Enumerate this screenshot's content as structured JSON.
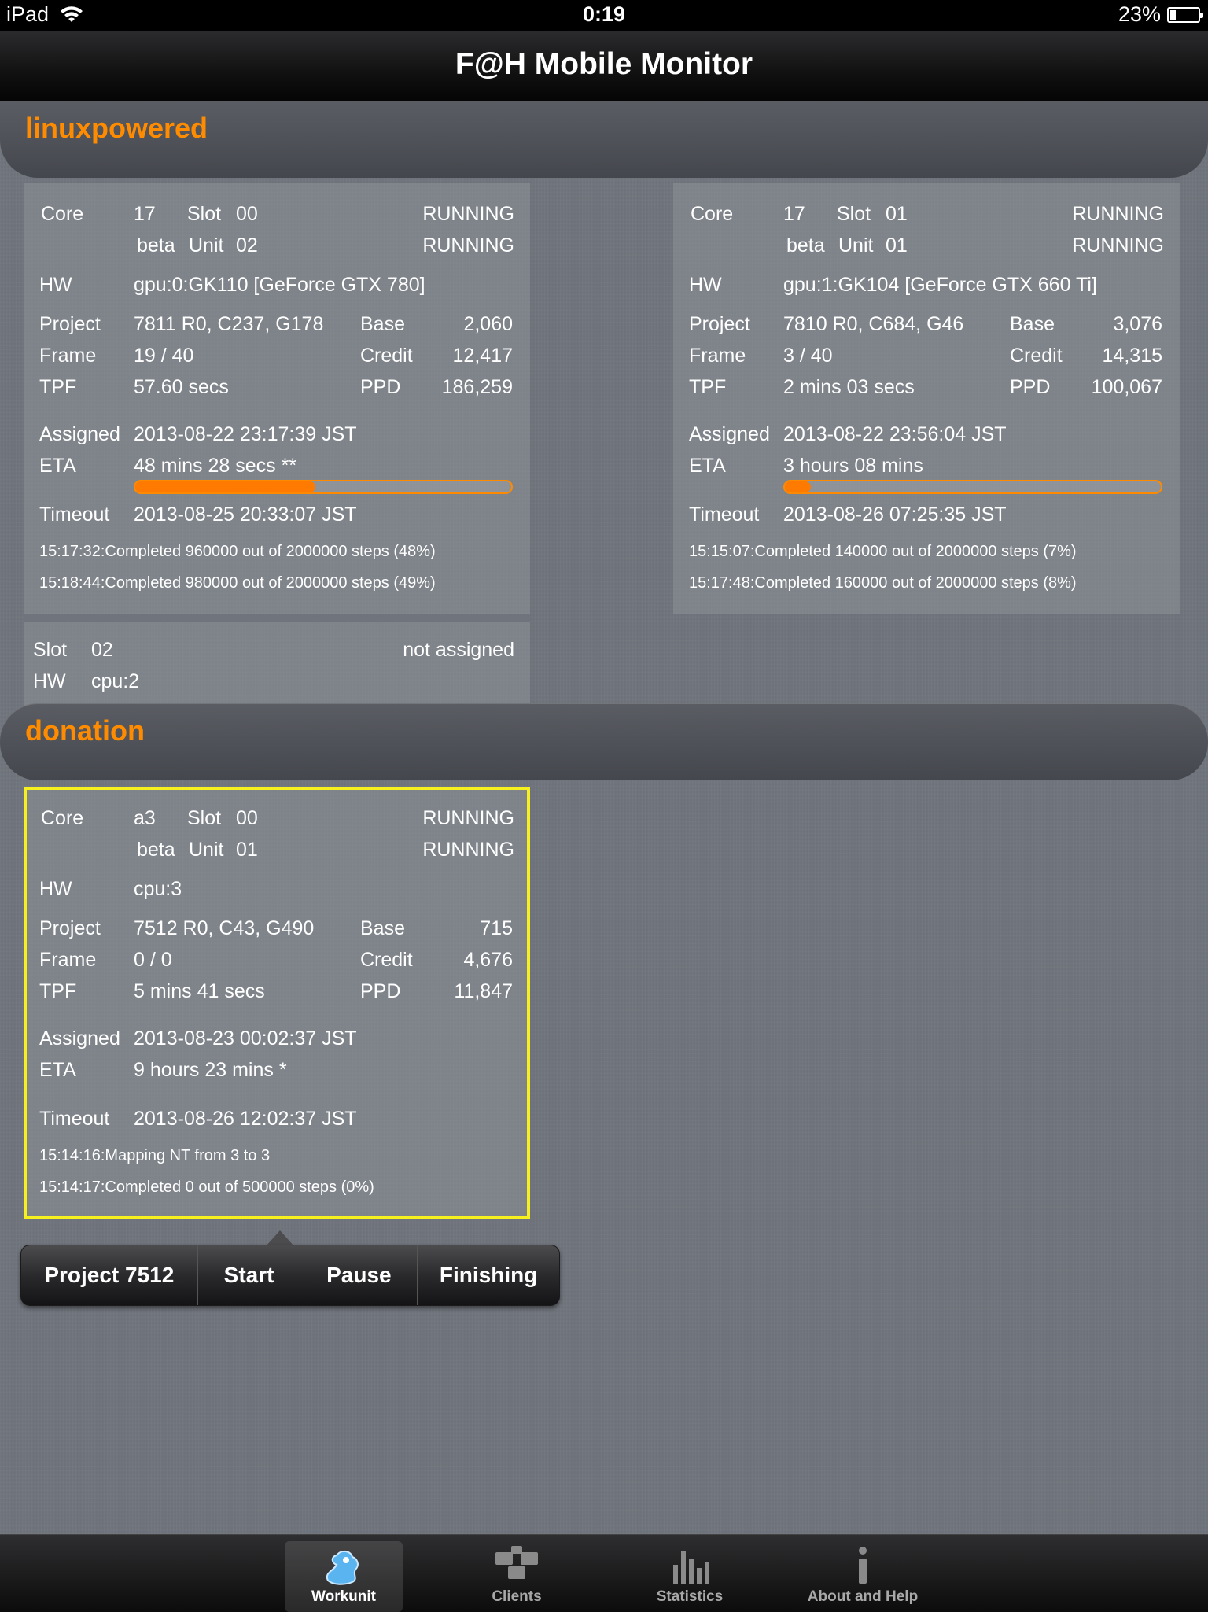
{
  "statusbar": {
    "device": "iPad",
    "time": "0:19",
    "battery": "23%"
  },
  "navbar": {
    "title": "F@H Mobile Monitor"
  },
  "clients": [
    {
      "name": "linuxpowered",
      "slots": [
        {
          "core": "17",
          "slot": "00",
          "beta": "beta",
          "unit": "02",
          "state1": "RUNNING",
          "state2": "RUNNING",
          "hw": "gpu:0:GK110 [GeForce GTX 780]",
          "project": "7811 R0, C237, G178",
          "base": "2,060",
          "frame": "19 / 40",
          "credit": "12,417",
          "tpf": "57.60 secs",
          "ppd": "186,259",
          "assigned": "2013-08-22 23:17:39 JST",
          "eta": "48 mins 28 secs **",
          "progress": 0.48,
          "timeout": "2013-08-25 20:33:07 JST",
          "log": [
            "15:17:32:Completed 960000 out of 2000000 steps (48%)",
            "15:18:44:Completed 980000 out of 2000000 steps (49%)"
          ]
        },
        {
          "core": "17",
          "slot": "01",
          "beta": "beta",
          "unit": "01",
          "state1": "RUNNING",
          "state2": "RUNNING",
          "hw": "gpu:1:GK104 [GeForce GTX 660 Ti]",
          "project": "7810 R0, C684, G46",
          "base": "3,076",
          "frame": "3 / 40",
          "credit": "14,315",
          "tpf": "2 mins 03 secs",
          "ppd": "100,067",
          "assigned": "2013-08-22 23:56:04 JST",
          "eta": "3 hours 08 mins",
          "progress": 0.07,
          "timeout": "2013-08-26 07:25:35 JST",
          "log": [
            "15:15:07:Completed 140000 out of 2000000 steps (7%)",
            "15:17:48:Completed 160000 out of 2000000 steps (8%)"
          ]
        }
      ],
      "unassigned": {
        "slot": "02",
        "status": "not assigned",
        "hw": "cpu:2"
      }
    },
    {
      "name": "donation",
      "slots": [
        {
          "core": "a3",
          "slot": "00",
          "beta": "beta",
          "unit": "01",
          "state1": "RUNNING",
          "state2": "RUNNING",
          "hw": "cpu:3",
          "project": "7512 R0, C43, G490",
          "base": "715",
          "frame": "0 / 0",
          "credit": "4,676",
          "tpf": "5 mins 41 secs",
          "ppd": "11,847",
          "assigned": "2013-08-23 00:02:37 JST",
          "eta": "9 hours 23 mins *",
          "timeout": "2013-08-26 12:02:37 JST",
          "log": [
            "15:14:16:Mapping NT from 3 to 3",
            "15:14:17:Completed 0 out of 500000 steps  (0%)"
          ]
        }
      ]
    }
  ],
  "labels": {
    "core": "Core",
    "slot": "Slot",
    "unit": "Unit",
    "hw": "HW",
    "project": "Project",
    "frame": "Frame",
    "tpf": "TPF",
    "base": "Base",
    "credit": "Credit",
    "ppd": "PPD",
    "assigned": "Assigned",
    "eta": "ETA",
    "timeout": "Timeout"
  },
  "actions": {
    "project": "Project 7512",
    "start": "Start",
    "pause": "Pause",
    "finishing": "Finishing"
  },
  "tabs": [
    {
      "label": "Workunit",
      "icon": "workunit-icon",
      "active": true
    },
    {
      "label": "Clients",
      "icon": "clients-icon"
    },
    {
      "label": "Statistics",
      "icon": "statistics-icon"
    },
    {
      "label": "About and Help",
      "icon": "info-icon"
    }
  ],
  "colors": {
    "accent": "#ff8c00",
    "selection": "#f5f01e",
    "progress": "#ff7a00"
  }
}
